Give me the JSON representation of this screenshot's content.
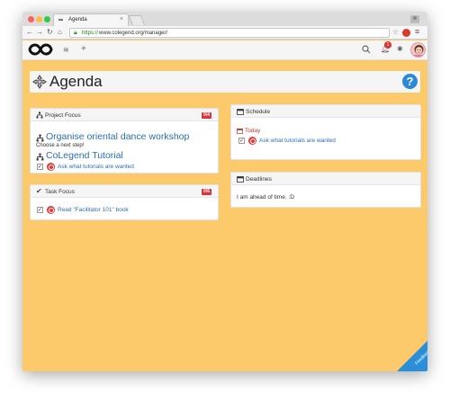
{
  "browser": {
    "tab_title": "Agenda",
    "url_https": "https://",
    "url_rest": "www.colegend.org/manager/"
  },
  "navbar": {
    "notification_count": "1"
  },
  "page": {
    "title": "Agenda"
  },
  "project_focus": {
    "title": "Project Focus",
    "badge": "0/4",
    "project1": "Organise oriental dance workshop",
    "project1_note": "Choose a next step!",
    "project2": "CoLegend Tutorial",
    "task": "Ask what tutorials are wanted"
  },
  "task_focus": {
    "title": "Task Focus",
    "badge": "0/6",
    "task": "Read \"Facilitator 101\" book"
  },
  "schedule": {
    "title": "Schedule",
    "today_label": "Today",
    "task": "Ask what tutorials are wanted"
  },
  "deadlines": {
    "title": "Deadlines",
    "message": "I am ahead of time. :D"
  },
  "feedback": {
    "label": "Feedback"
  },
  "colors": {
    "background": "#fcc96b",
    "link": "#2a6fb5",
    "badge": "#d9343a",
    "help": "#2c8ad6",
    "feedback": "#2a8fd8"
  }
}
